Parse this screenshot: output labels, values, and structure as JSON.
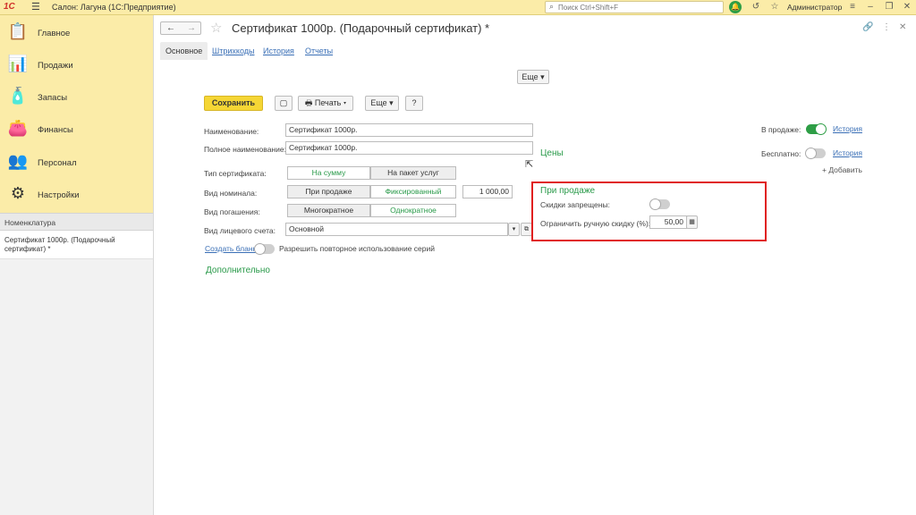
{
  "topbar": {
    "logo": "1С",
    "app_title": "Салон: Лагуна  (1С:Предприятие)",
    "search_placeholder": "Поиск Ctrl+Shift+F",
    "user": "Администратор"
  },
  "sidebar": {
    "sections": [
      {
        "label": "Главное",
        "icon": "📋"
      },
      {
        "label": "Продажи",
        "icon": "📊"
      },
      {
        "label": "Запасы",
        "icon": "🧴"
      },
      {
        "label": "Финансы",
        "icon": "👛"
      },
      {
        "label": "Персонал",
        "icon": "👥"
      },
      {
        "label": "Настройки",
        "icon": "⚙"
      }
    ],
    "nav_header": "Номенклатура",
    "open_window": "Сертификат 1000р. (Подарочный сертификат) *"
  },
  "form": {
    "title": "Сертификат 1000р. (Подарочный сертификат) *",
    "tabs": [
      "Основное",
      "Штрихкоды",
      "История",
      "Отчеты"
    ],
    "more_top": "Еще",
    "toolbar": {
      "save": "Сохранить",
      "print": "Печать",
      "more": "Еще",
      "help": "?"
    },
    "fields": {
      "name_label": "Наименование:",
      "name_value": "Сертификат 1000р.",
      "fullname_label": "Полное наименование:",
      "fullname_value": "Сертификат 1000р.",
      "cert_type_label": "Тип сертификата:",
      "cert_type_options": [
        "На сумму",
        "На пакет услуг"
      ],
      "nominal_label": "Вид номинала:",
      "nominal_options": [
        "При продаже",
        "Фиксированный"
      ],
      "nominal_value": "1 000,00",
      "repay_label": "Вид погашения:",
      "repay_options": [
        "Многократное",
        "Однократное"
      ],
      "account_label": "Вид лицевого счета:",
      "account_value": "Основной",
      "create_forms": "Создать бланки",
      "allow_reuse": "Разрешить повторное использование серий",
      "additional": "Дополнительно"
    },
    "right": {
      "on_sale_label": "В продаже:",
      "on_sale_history": "История",
      "on_sale_enabled": true,
      "free_label": "Бесплатно:",
      "free_history": "История",
      "free_enabled": false,
      "prices_header": "Цены",
      "add_link": "+ Добавить",
      "sale_header": "При продаже",
      "discounts_label": "Скидки запрещены:",
      "discounts_enabled": false,
      "limit_label": "Ограничить ручную скидку (%):",
      "limit_value": "50,00"
    }
  },
  "colors": {
    "accent_yellow": "#fbeca8",
    "save_button": "#f5d635",
    "green": "#2a9a4a",
    "link_blue": "#3a6fb6",
    "highlight_red": "#e02020"
  }
}
